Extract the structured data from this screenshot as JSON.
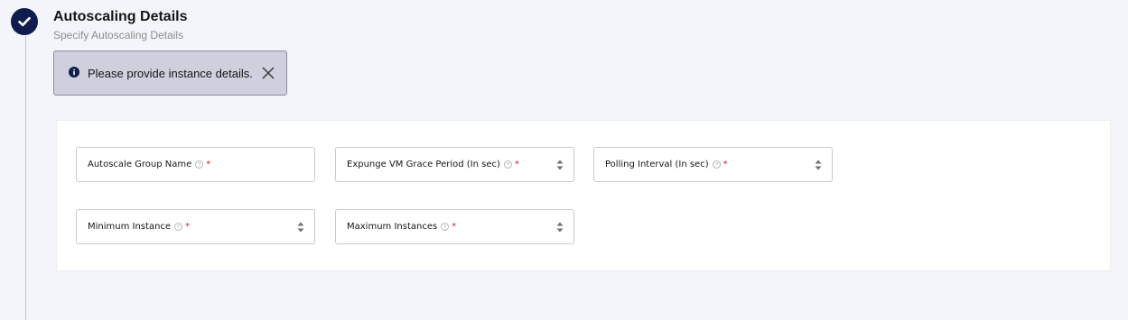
{
  "step": {
    "title": "Autoscaling Details",
    "subtitle": "Specify Autoscaling Details",
    "status_icon": "checkmark-icon"
  },
  "notification": {
    "text": "Please provide instance details.",
    "icon": "info-icon",
    "close_icon": "close-icon"
  },
  "form": {
    "fields": [
      {
        "label": "Autoscale Group Name",
        "required": "*",
        "type": "text",
        "value": ""
      },
      {
        "label": "Expunge VM Grace Period (In sec)",
        "required": "*",
        "type": "number",
        "value": ""
      },
      {
        "label": "Polling Interval (In sec)",
        "required": "*",
        "type": "number",
        "value": ""
      },
      {
        "label": "Minimum Instance",
        "required": "*",
        "type": "number",
        "value": ""
      },
      {
        "label": "Maximum Instances",
        "required": "*",
        "type": "number",
        "value": ""
      }
    ]
  },
  "colors": {
    "accent": "#0f1c4d",
    "background": "#f4f4fb",
    "notification_bg": "#cfcfdd",
    "required": "#da1e28"
  }
}
